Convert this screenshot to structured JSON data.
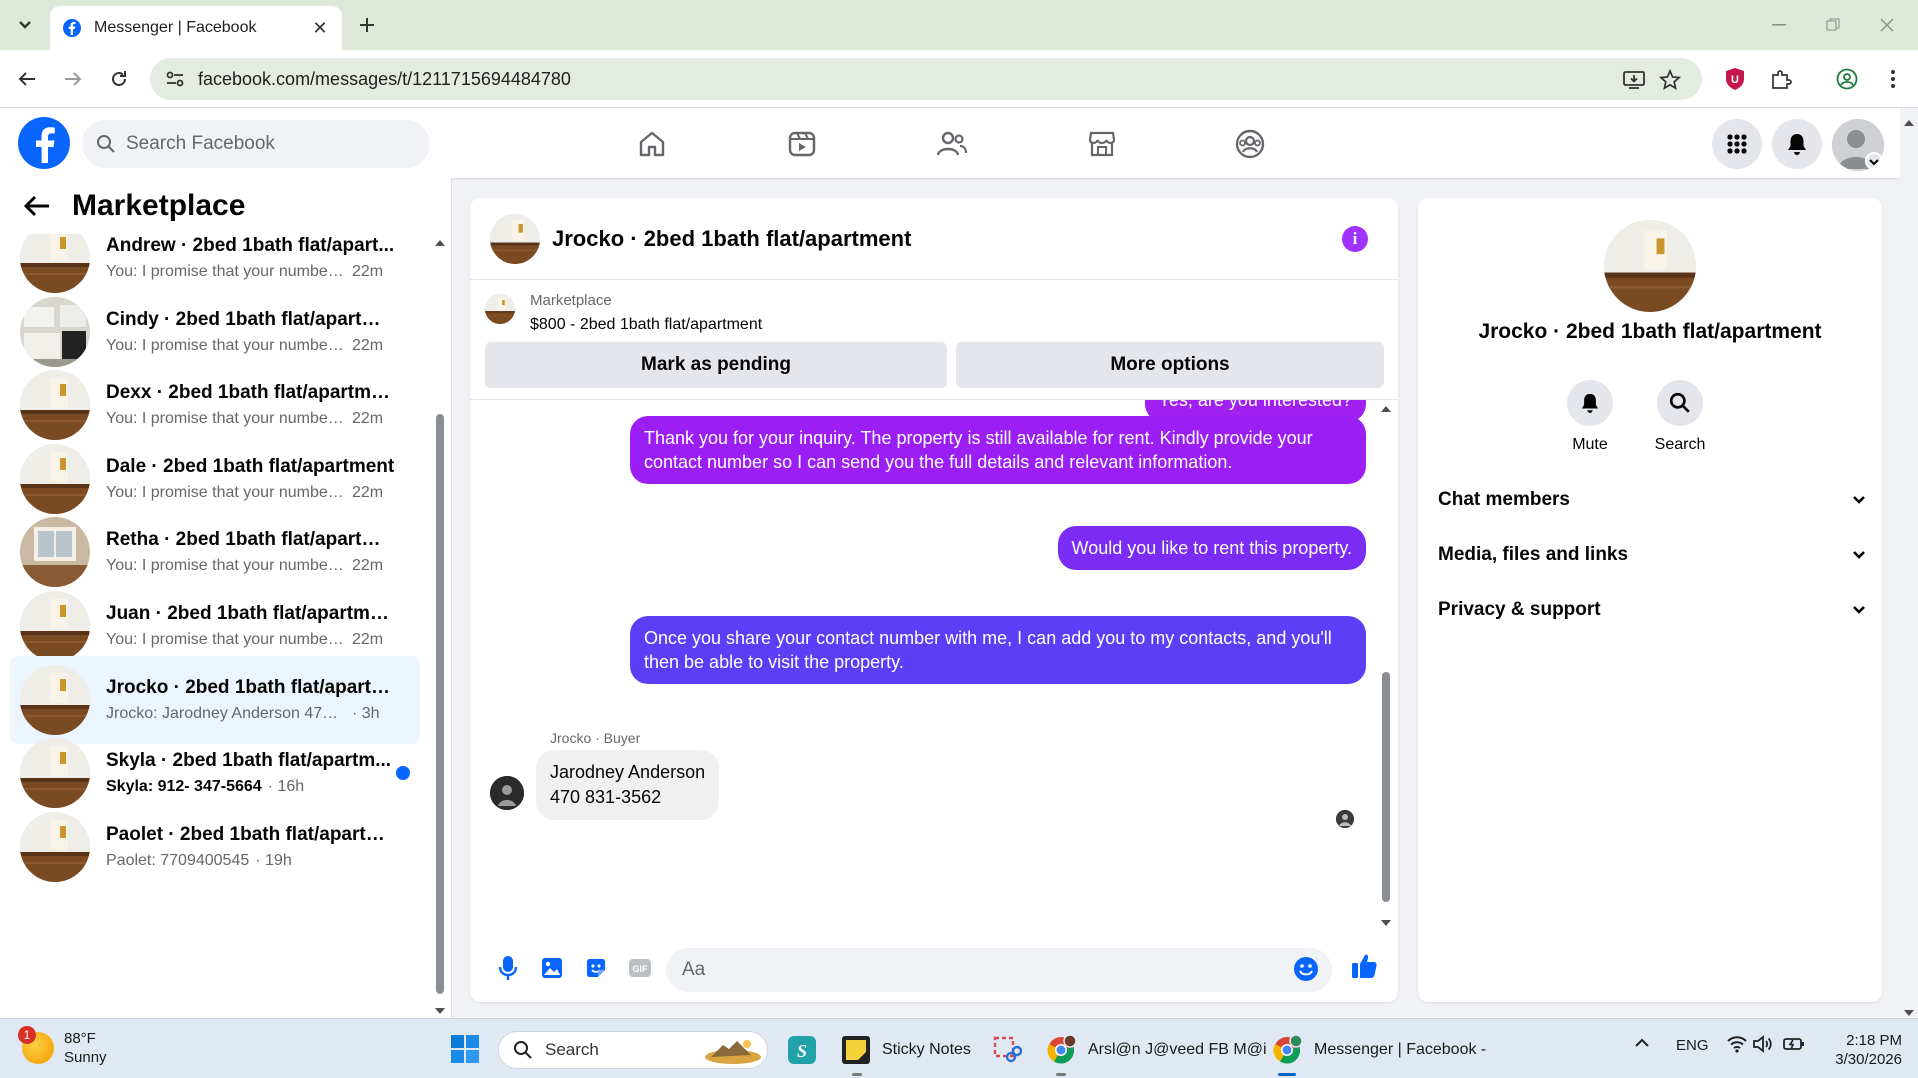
{
  "browser": {
    "tab_title": "Messenger | Facebook",
    "url": "facebook.com/messages/t/1211715694484780"
  },
  "fb": {
    "search_placeholder": "Search Facebook"
  },
  "sidebar": {
    "title": "Marketplace",
    "conversations": [
      {
        "name": "Andrew · 2bed 1bath flat/apart...",
        "preview": "You: I promise that your number ...",
        "time": "22m",
        "unread": false,
        "active": false,
        "thumb": "empty-room"
      },
      {
        "name": "Cindy · 2bed 1bath flat/apartment",
        "preview": "You: I promise that your number ...",
        "time": "22m",
        "unread": false,
        "active": false,
        "thumb": "kitchen"
      },
      {
        "name": "Dexx · 2bed 1bath flat/apartment",
        "preview": "You: I promise that your number ...",
        "time": "22m",
        "unread": false,
        "active": false,
        "thumb": "empty-room"
      },
      {
        "name": "Dale · 2bed 1bath flat/apartment",
        "preview": "You: I promise that your number ...",
        "time": "22m",
        "unread": false,
        "active": false,
        "thumb": "empty-room"
      },
      {
        "name": "Retha · 2bed 1bath flat/apartment",
        "preview": "You: I promise that your number ...",
        "time": "22m",
        "unread": false,
        "active": false,
        "thumb": "window-room"
      },
      {
        "name": "Juan · 2bed 1bath flat/apartment",
        "preview": "You: I promise that your number ...",
        "time": "22m",
        "unread": false,
        "active": false,
        "thumb": "empty-room"
      },
      {
        "name": "Jrocko · 2bed 1bath flat/apartm...",
        "preview": "Jrocko: Jarodney Anderson 470 83...",
        "time": "· 3h",
        "unread": false,
        "active": true,
        "thumb": "empty-room"
      },
      {
        "name": "Skyla · 2bed 1bath flat/apartm...",
        "preview": "Skyla: 912- 347-5664",
        "time": "· 16h",
        "unread": true,
        "active": false,
        "thumb": "empty-room"
      },
      {
        "name": "Paolet · 2bed 1bath flat/apartme...",
        "preview": "Paolet: 7709400545",
        "time": "· 19h",
        "unread": false,
        "active": false,
        "thumb": "empty-room"
      }
    ]
  },
  "chat": {
    "title": "Jrocko · 2bed 1bath flat/apartment",
    "listing": {
      "kicker": "Marketplace",
      "title": "$800 - 2bed 1bath flat/apartment",
      "btn_pending": "Mark as pending",
      "btn_more": "More options"
    },
    "partial_message": "Yes, are you interested?",
    "messages_out": [
      "Thank you for your inquiry. The property is still available for rent. Kindly provide your contact number so I can send you the full details and relevant information.",
      "Would you like to rent this property.",
      "Once you share your contact number with me, I can add you to my contacts, and you'll then be able to visit the property."
    ],
    "buyer_meta": "Jrocko · Buyer",
    "incoming": {
      "line1": "Jarodney Anderson",
      "line2": "470 831-3562"
    },
    "composer_placeholder": "Aa",
    "colors": {
      "bubble_1": "#a020f0",
      "bubble_2": "#7a2cf5",
      "bubble_3": "#5b3ef5"
    }
  },
  "info": {
    "name": "Jrocko · 2bed 1bath flat/apartment",
    "mute": "Mute",
    "search": "Search",
    "rows": [
      "Chat members",
      "Media, files and links",
      "Privacy & support"
    ]
  },
  "taskbar": {
    "weather_temp": "88°F",
    "weather_desc": "Sunny",
    "weather_badge": "1",
    "search": "Search",
    "apps": [
      {
        "label": "Sticky Notes"
      },
      {
        "label": "Arsl@n J@veed FB M@i"
      },
      {
        "label": "Messenger | Facebook -"
      }
    ],
    "lang": "ENG",
    "time": "2:18 PM",
    "date": "3/30/2026"
  }
}
